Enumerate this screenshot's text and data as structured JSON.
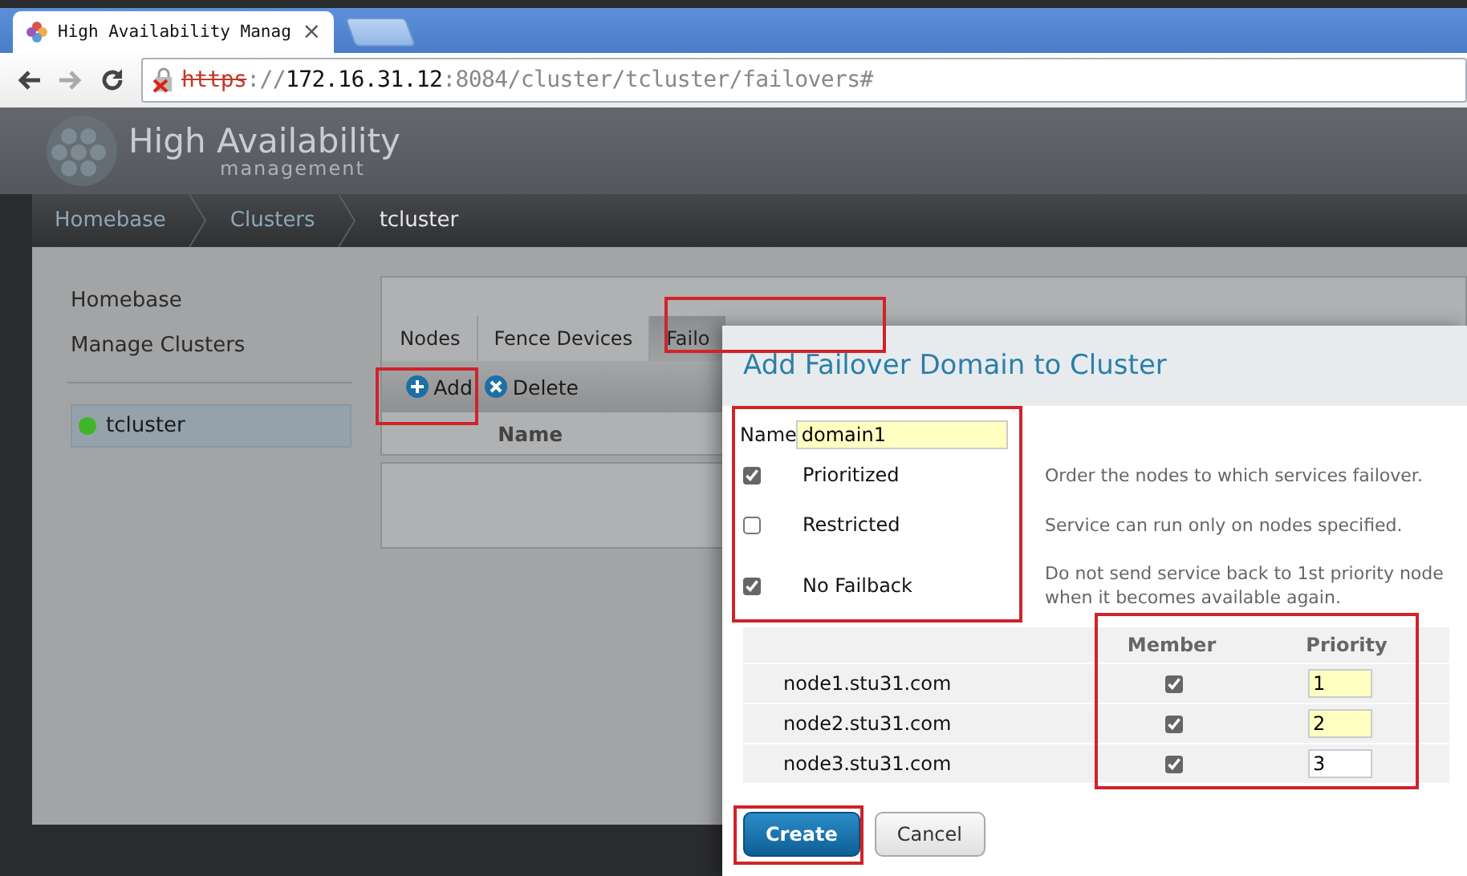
{
  "browser": {
    "tab": {
      "title": "High Availability Manag",
      "close": "×"
    },
    "url": [
      {
        "text": "https",
        "kind": "insecure"
      },
      {
        "text": "://",
        "kind": "dim"
      },
      {
        "text": "172.16.31.12",
        "kind": "host"
      },
      {
        "text": ":8084/cluster/tcluster/failovers#",
        "kind": "dim"
      }
    ]
  },
  "app": {
    "logo_title": "High Availability",
    "logo_subtitle": "management"
  },
  "breadcrumb": [
    "Homebase",
    "Clusters",
    "tcluster"
  ],
  "sidebar": {
    "links": [
      "Homebase",
      "Manage Clusters"
    ],
    "clusters": [
      {
        "name": "tcluster",
        "selected": true,
        "color": "#3fb52a"
      }
    ]
  },
  "tabs": [
    {
      "label": "Nodes",
      "selected": false
    },
    {
      "label": "Fence Devices",
      "selected": false
    },
    {
      "label": "Failo",
      "selected": true
    }
  ],
  "toolbar": [
    {
      "label": "Add",
      "kind": "add"
    },
    {
      "label": "Delete",
      "kind": "delete"
    }
  ],
  "table": {
    "columns": [
      "Name"
    ]
  },
  "dialog": {
    "title": "Add Failover Domain to Cluster",
    "name_label": "Name",
    "name_value": "domain1",
    "options": [
      {
        "label": "Prioritized",
        "checked": true,
        "description": "Order the nodes to which services failover."
      },
      {
        "label": "Restricted",
        "checked": false,
        "description": "Service can run only on nodes specified."
      },
      {
        "label": "No Failback",
        "checked": true,
        "description": "Do not send service back to 1st priority node when it becomes available again."
      }
    ],
    "columns": [
      "Member",
      "Priority"
    ],
    "nodes": [
      {
        "name": "node1.stu31.com",
        "member": true,
        "priority": "1",
        "highlighted": true
      },
      {
        "name": "node2.stu31.com",
        "member": true,
        "priority": "2",
        "highlighted": true
      },
      {
        "name": "node3.stu31.com",
        "member": true,
        "priority": "3",
        "highlighted": false
      }
    ],
    "buttons": [
      {
        "label": "Create",
        "kind": "primary"
      },
      {
        "label": "Cancel",
        "kind": "secondary"
      }
    ]
  }
}
